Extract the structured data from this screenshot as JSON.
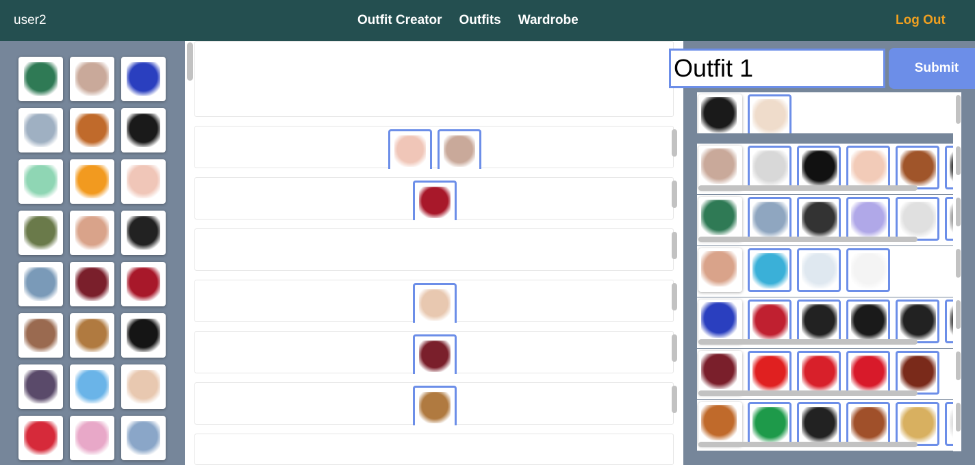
{
  "header": {
    "username": "user2",
    "nav": [
      "Outfit Creator",
      "Outfits",
      "Wardrobe"
    ],
    "logout_label": "Log Out"
  },
  "colors": {
    "header_bg": "#244f50",
    "accent": "#6c8ee8",
    "logout": "#f0a020",
    "panel_bg": "#76869a"
  },
  "wardrobe_items": [
    {
      "icon": "floral-pants",
      "color": "#2f7a55"
    },
    {
      "icon": "beige-blazer",
      "color": "#c9a99a"
    },
    {
      "icon": "blue-pompom-sandal",
      "color": "#2a3fbf"
    },
    {
      "icon": "denim-shorts",
      "color": "#9fb0c2"
    },
    {
      "icon": "brown-belts",
      "color": "#c06a2b"
    },
    {
      "icon": "black-off-shoulder-top",
      "color": "#1a1a1a"
    },
    {
      "icon": "mint-statement-necklace",
      "color": "#8fd6b4"
    },
    {
      "icon": "orange-bead-bracelet",
      "color": "#f29a1f"
    },
    {
      "icon": "pink-crop-tee",
      "color": "#f0c6b8"
    },
    {
      "icon": "olive-shorts",
      "color": "#6a7a4a"
    },
    {
      "icon": "nude-bikini",
      "color": "#d9a38a"
    },
    {
      "icon": "black-high-top-sneaker",
      "color": "#222222"
    },
    {
      "icon": "floral-crop-top",
      "color": "#7a9ab8"
    },
    {
      "icon": "burgundy-handbag",
      "color": "#7a1f2b"
    },
    {
      "icon": "red-skater-skirt",
      "color": "#a8182a"
    },
    {
      "icon": "fur-pompom-keychain",
      "color": "#9a6a50"
    },
    {
      "icon": "plaid-watch",
      "color": "#b07a40"
    },
    {
      "icon": "black-mary-jane-heel",
      "color": "#151515"
    },
    {
      "icon": "sunglasses",
      "color": "#5a4a6a"
    },
    {
      "icon": "blue-patterned-swimsuit",
      "color": "#6ab4e8"
    },
    {
      "icon": "nude-lace-up-oxfords",
      "color": "#e8c8b0"
    },
    {
      "icon": "striped-tank",
      "color": "#d62a3a"
    },
    {
      "icon": "pink-off-shoulder-blouse",
      "color": "#e8a8c8"
    },
    {
      "icon": "light-jeans",
      "color": "#8aa6c8"
    }
  ],
  "outfit_slots": [
    {
      "name": "slot-headwear",
      "items": []
    },
    {
      "name": "slot-tops",
      "items": [
        {
          "icon": "pink-crop-tee",
          "color": "#f0c6b8"
        },
        {
          "icon": "beige-blazer",
          "color": "#c9a99a"
        }
      ]
    },
    {
      "name": "slot-bottoms",
      "items": [
        {
          "icon": "red-skater-skirt",
          "color": "#a8182a"
        }
      ]
    },
    {
      "name": "slot-swimwear",
      "items": []
    },
    {
      "name": "slot-shoes",
      "items": [
        {
          "icon": "nude-lace-up-oxfords",
          "color": "#e8c8b0"
        }
      ]
    },
    {
      "name": "slot-bags",
      "items": [
        {
          "icon": "burgundy-handbag",
          "color": "#7a1f2b"
        }
      ]
    },
    {
      "name": "slot-accessories",
      "items": [
        {
          "icon": "plaid-watch",
          "color": "#b07a40"
        }
      ]
    }
  ],
  "outfit_form": {
    "name_value": "Outfit 1",
    "submit_label": "Submit"
  },
  "category_rows": [
    {
      "name": "hats",
      "items": [
        {
          "icon": "black-fedora",
          "color": "#1a1a1a"
        },
        {
          "icon": "cream-wide-brim-hat",
          "color": "#efdccb"
        }
      ]
    },
    {
      "name": "tops",
      "items": [
        {
          "icon": "beige-blazer",
          "color": "#c9a99a"
        },
        {
          "icon": "sketch-print-shirt",
          "color": "#d8d8d8"
        },
        {
          "icon": "black-coat",
          "color": "#111111"
        },
        {
          "icon": "blush-tee",
          "color": "#f2cbb8"
        },
        {
          "icon": "brown-check-coat",
          "color": "#a0552a"
        },
        {
          "icon": "dark-top",
          "color": "#333333"
        }
      ]
    },
    {
      "name": "bottoms",
      "items": [
        {
          "icon": "floral-pants",
          "color": "#2f7a55"
        },
        {
          "icon": "tie-dye-jeans",
          "color": "#8fa6c0"
        },
        {
          "icon": "striped-trousers",
          "color": "#333333"
        },
        {
          "icon": "lip-print-top",
          "color": "#b0a8e8"
        },
        {
          "icon": "perfect-wave-tee",
          "color": "#e0e0e0"
        },
        {
          "icon": "grey-item",
          "color": "#999999"
        }
      ]
    },
    {
      "name": "swimwear",
      "items": [
        {
          "icon": "nude-bikini",
          "color": "#d9a38a"
        },
        {
          "icon": "blue-bikini",
          "color": "#3ab0d8"
        },
        {
          "icon": "white-gown",
          "color": "#dfe8f0"
        },
        {
          "icon": "white-mini-dress",
          "color": "#f4f4f4"
        }
      ]
    },
    {
      "name": "shoes",
      "items": [
        {
          "icon": "blue-pompom-sandal",
          "color": "#2a3fbf"
        },
        {
          "icon": "red-spot-sneaker",
          "color": "#c02030"
        },
        {
          "icon": "black-pointed-flat",
          "color": "#222222"
        },
        {
          "icon": "black-pump",
          "color": "#1a1a1a"
        },
        {
          "icon": "black-loafer",
          "color": "#222222"
        },
        {
          "icon": "dark-shoe",
          "color": "#444444"
        }
      ]
    },
    {
      "name": "bags",
      "items": [
        {
          "icon": "burgundy-handbag",
          "color": "#7a1f2b"
        },
        {
          "icon": "red-tote",
          "color": "#e02020"
        },
        {
          "icon": "red-mini-crossbody",
          "color": "#d8202a"
        },
        {
          "icon": "red-round-bag",
          "color": "#d81a2a"
        },
        {
          "icon": "brown-bucket-bag",
          "color": "#7a2a1a"
        }
      ]
    },
    {
      "name": "accessories",
      "items": [
        {
          "icon": "brown-belts",
          "color": "#c06a2b"
        },
        {
          "icon": "green-scarf",
          "color": "#1e9a4a"
        },
        {
          "icon": "black-watch",
          "color": "#222222"
        },
        {
          "icon": "statement-earrings",
          "color": "#a0502a"
        },
        {
          "icon": "gold-charm-bracelet",
          "color": "#d8b060"
        },
        {
          "icon": "light-item",
          "color": "#dddddd"
        }
      ]
    }
  ]
}
